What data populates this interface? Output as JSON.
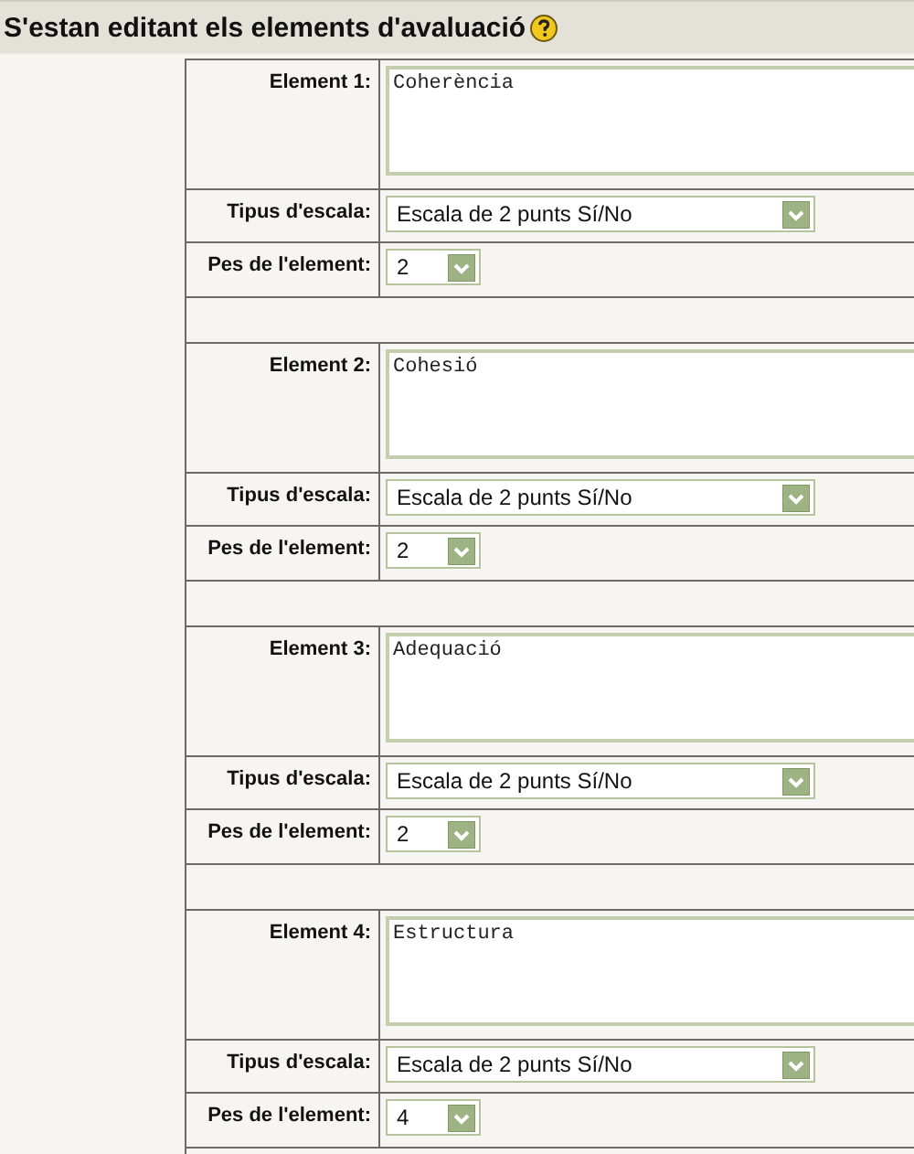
{
  "title": "S'estan editant els elements d'avaluació",
  "elements": [
    {
      "label": "Element 1:",
      "description": "Coherència",
      "scale_label": "Tipus d'escala:",
      "scale": "Escala de 2 punts Sí/No",
      "weight_label": "Pes de l'element:",
      "weight": "2"
    },
    {
      "label": "Element 2:",
      "description": "Cohesió",
      "scale_label": "Tipus d'escala:",
      "scale": "Escala de 2 punts Sí/No",
      "weight_label": "Pes de l'element:",
      "weight": "2"
    },
    {
      "label": "Element 3:",
      "description": "Adequació",
      "scale_label": "Tipus d'escala:",
      "scale": "Escala de 2 punts Sí/No",
      "weight_label": "Pes de l'element:",
      "weight": "2"
    },
    {
      "label": "Element 4:",
      "description": "Estructura",
      "scale_label": "Tipus d'escala:",
      "scale": "Escala de 2 punts Sí/No",
      "weight_label": "Pes de l'element:",
      "weight": "4"
    }
  ]
}
